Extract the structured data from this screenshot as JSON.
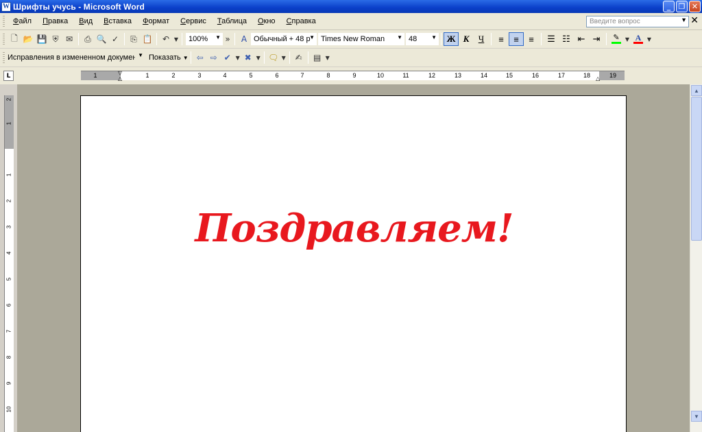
{
  "window": {
    "title": "Шрифты учусь - Microsoft Word",
    "app_icon": "W",
    "minimize_glyph": "_",
    "maximize_glyph": "❐",
    "close_glyph": "✕"
  },
  "menu": {
    "items": [
      "Файл",
      "Правка",
      "Вид",
      "Вставка",
      "Формат",
      "Сервис",
      "Таблица",
      "Окно",
      "Справка"
    ],
    "help_placeholder": "Введите вопрос",
    "doc_close": "✕"
  },
  "toolbar_standard": {
    "zoom": "100%",
    "more": "»"
  },
  "toolbar_formatting": {
    "style": "Обычный + 48 р",
    "font": "Times New Roman",
    "size": "48",
    "bold_label": "Ж",
    "italic_label": "К",
    "underline_label": "Ч",
    "highlight_color": "#00ff00",
    "font_color": "#ff0000"
  },
  "toolbar_review": {
    "display_mode": "Исправления в измененном докумен",
    "show_label": "Показать"
  },
  "ruler": {
    "tab_selector": "L",
    "horizontal_numbers": [
      "1",
      "1",
      "2",
      "3",
      "4",
      "5",
      "6",
      "7",
      "8",
      "9",
      "10",
      "11",
      "12",
      "13",
      "14",
      "15",
      "16",
      "17",
      "18",
      "19"
    ],
    "vertical_numbers": [
      "2",
      "1",
      "1",
      "2",
      "3",
      "4",
      "5",
      "6",
      "7",
      "8",
      "9",
      "10"
    ]
  },
  "document": {
    "text": "Поздравляем!",
    "text_color": "#e8181e"
  }
}
